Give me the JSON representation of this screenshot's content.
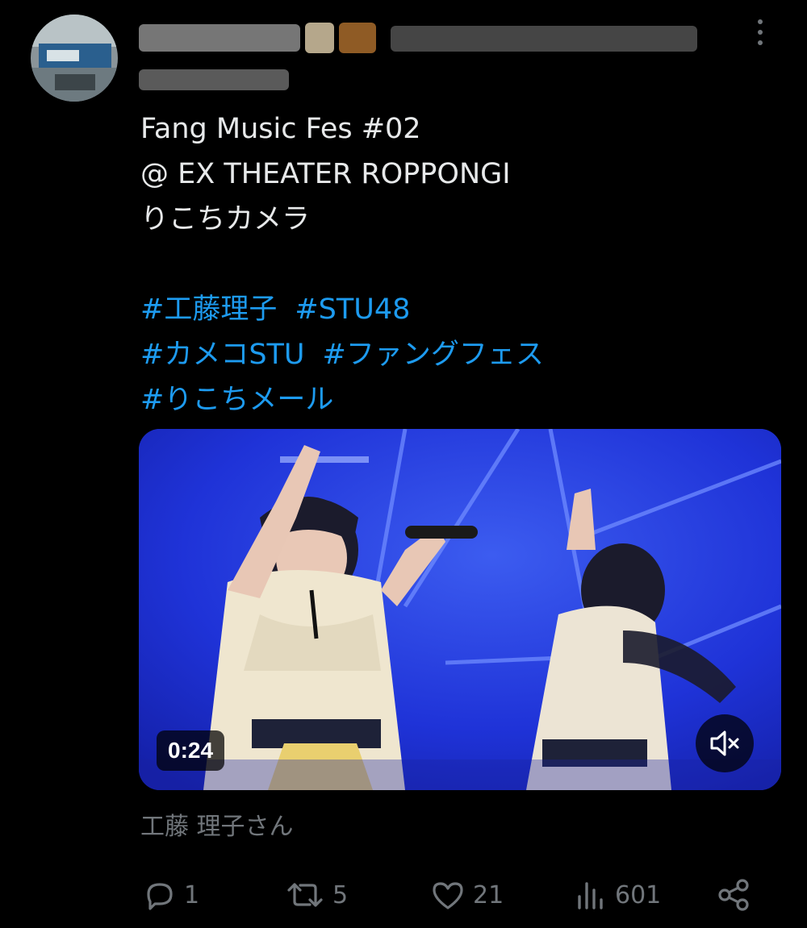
{
  "tweet": {
    "lines": [
      "Fang Music Fes #02",
      "@ EX THEATER ROPPONGI",
      "りこちカメラ"
    ],
    "hashtag_rows": [
      [
        "#工藤理子",
        "#STU48"
      ],
      [
        "#カメコSTU",
        "#ファングフェス"
      ],
      [
        "#りこちメール"
      ]
    ]
  },
  "media": {
    "duration": "0:24",
    "mute_icon": "volume-muted-icon"
  },
  "tagged_user": "工藤 理子さん",
  "actions": {
    "reply": {
      "icon": "reply-icon",
      "count": "1"
    },
    "retweet": {
      "icon": "retweet-icon",
      "count": "5"
    },
    "like": {
      "icon": "heart-icon",
      "count": "21"
    },
    "views": {
      "icon": "views-icon",
      "count": "601"
    },
    "share": {
      "icon": "share-icon"
    }
  },
  "colors": {
    "background": "#000000",
    "text": "#e7e9ea",
    "link": "#1d9bf0",
    "muted": "#71767b"
  }
}
